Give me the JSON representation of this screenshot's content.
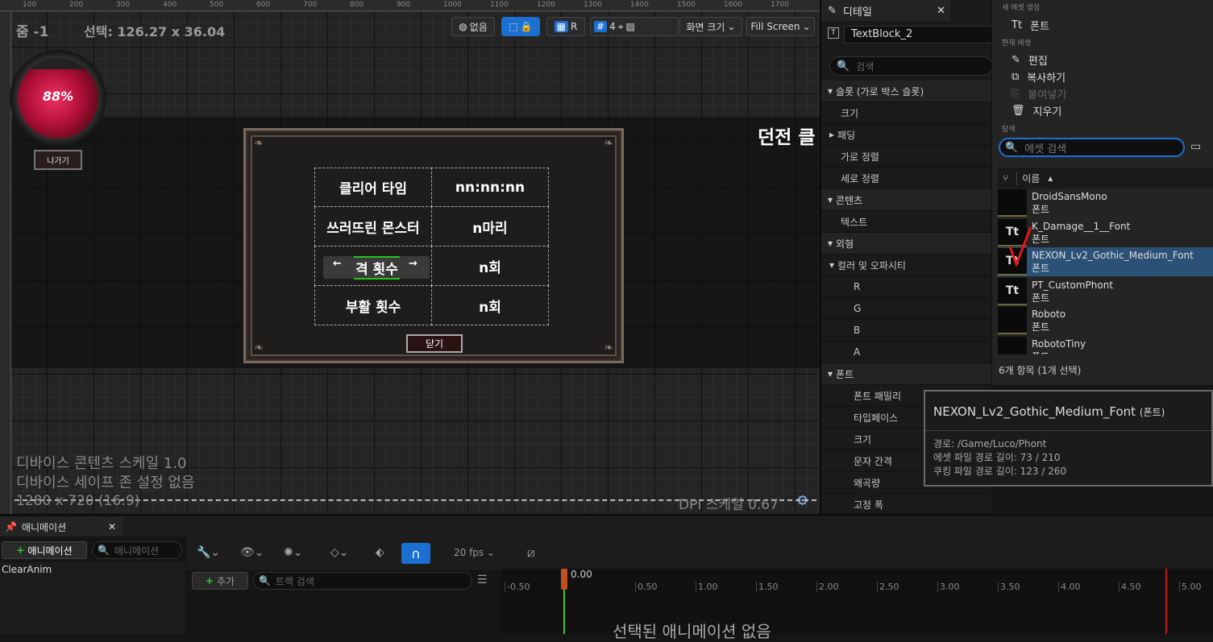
{
  "viewport": {
    "zoom_label": "줌 -1",
    "selection_label": "선택: 126.27 x 36.04",
    "ruler_ticks": [
      "100",
      "200",
      "300",
      "400",
      "500",
      "600",
      "700",
      "800",
      "900",
      "1000",
      "1100",
      "1200",
      "1300",
      "1400",
      "1500",
      "1600",
      "1700"
    ],
    "toolbar": {
      "localization_none": "없음",
      "r_label": "R",
      "grid_count": "4",
      "screen_size": "화면 크기",
      "fill_screen": "Fill Screen"
    },
    "hp_percent": "88%",
    "exit_button": "나가기",
    "dungeon_label": "던전 클",
    "device_scale": "디바이스 콘텐츠 스케일 1.0",
    "safe_zone": "디바이스 세이프 존 설정 없음",
    "resolution": "1280 x 720 (16:9)",
    "dpi_scale": "DPI 스케일 0.67"
  },
  "dialog": {
    "rows": [
      {
        "label": "클리어 타임",
        "value": "nn:nn:nn"
      },
      {
        "label": "쓰러뜨린 몬스터",
        "value": "n마리"
      },
      {
        "label": "격 횟수",
        "value": "n회"
      },
      {
        "label": "부활 횟수",
        "value": "n회"
      }
    ],
    "left_arrow": "←",
    "right_arrow": "→",
    "close_button": "닫기"
  },
  "details": {
    "tab_title": "디테일",
    "widget_name": "TextBlock_2",
    "search_placeholder": "검색",
    "rows": [
      {
        "label": "슬롯 (가로 박스 슬롯)",
        "type": "section"
      },
      {
        "label": "크기",
        "type": "prop"
      },
      {
        "label": "패딩",
        "type": "expand"
      },
      {
        "label": "가로 정렬",
        "type": "prop"
      },
      {
        "label": "세로 정렬",
        "type": "prop"
      },
      {
        "label": "콘텐츠",
        "type": "section"
      },
      {
        "label": "텍스트",
        "type": "prop"
      },
      {
        "label": "외형",
        "type": "section"
      },
      {
        "label": "컬러 및 오파시티",
        "type": "subsection"
      },
      {
        "label": "R",
        "type": "sub"
      },
      {
        "label": "G",
        "type": "sub"
      },
      {
        "label": "B",
        "type": "sub"
      },
      {
        "label": "A",
        "type": "sub"
      },
      {
        "label": "폰트",
        "type": "section"
      },
      {
        "label": "폰트 패밀리",
        "type": "sub"
      },
      {
        "label": "타입페이스",
        "type": "sub"
      },
      {
        "label": "크기",
        "type": "sub"
      },
      {
        "label": "문자 간격",
        "type": "sub"
      },
      {
        "label": "왜곡량",
        "type": "sub"
      },
      {
        "label": "고정 폭",
        "type": "sub"
      }
    ]
  },
  "picker": {
    "new_asset_header": "새 에셋 생성",
    "new_font": "폰트",
    "current_asset_header": "현재 에셋",
    "edit": "편집",
    "copy": "복사하기",
    "paste": "붙여넣기",
    "delete": "지우기",
    "browse_header": "탐색",
    "search_placeholder": "에셋 검색",
    "name_column": "이름",
    "assets": [
      {
        "name": "DroidSansMono",
        "type": "폰트",
        "selected": false
      },
      {
        "name": "K_Damage__1__Font",
        "type": "폰트",
        "selected": false
      },
      {
        "name": "NEXON_Lv2_Gothic_Medium_Font",
        "type": "폰트",
        "selected": true
      },
      {
        "name": "PT_CustomPhont",
        "type": "폰트",
        "selected": false
      },
      {
        "name": "Roboto",
        "type": "폰트",
        "selected": false
      },
      {
        "name": "RobotoTiny",
        "type": "폰트",
        "selected": false
      }
    ],
    "count_label": "6개 항목 (1개 선택)"
  },
  "tooltip": {
    "title": "NEXON_Lv2_Gothic_Medium_Font",
    "title_type": "(폰트)",
    "path": "경로: /Game/Luco/Phont",
    "asset_path_len": "에셋 파일 경로 길이: 73 / 210",
    "cook_path_len": "쿠킹 파일 경로 길이: 123 / 260"
  },
  "animation": {
    "tab_title": "애니메이션",
    "add_animation": "애니메이션",
    "search_placeholder": "애니메이션",
    "items": [
      "ClearAnim"
    ],
    "add_track": "추가",
    "track_search_placeholder": "트랙 검색",
    "fps": "20 fps",
    "playhead": "0.00",
    "timeline_ticks": [
      "-0.50",
      "0.50",
      "1.00",
      "1.50",
      "2.00",
      "2.50",
      "3.00",
      "3.50",
      "4.00",
      "4.50",
      "5.00"
    ],
    "no_animation": "선택된 애니메이션 없음"
  },
  "colors": {
    "accent": "#1a6fd1",
    "selection": "#2c5176",
    "hp_red": "#c0143c"
  }
}
